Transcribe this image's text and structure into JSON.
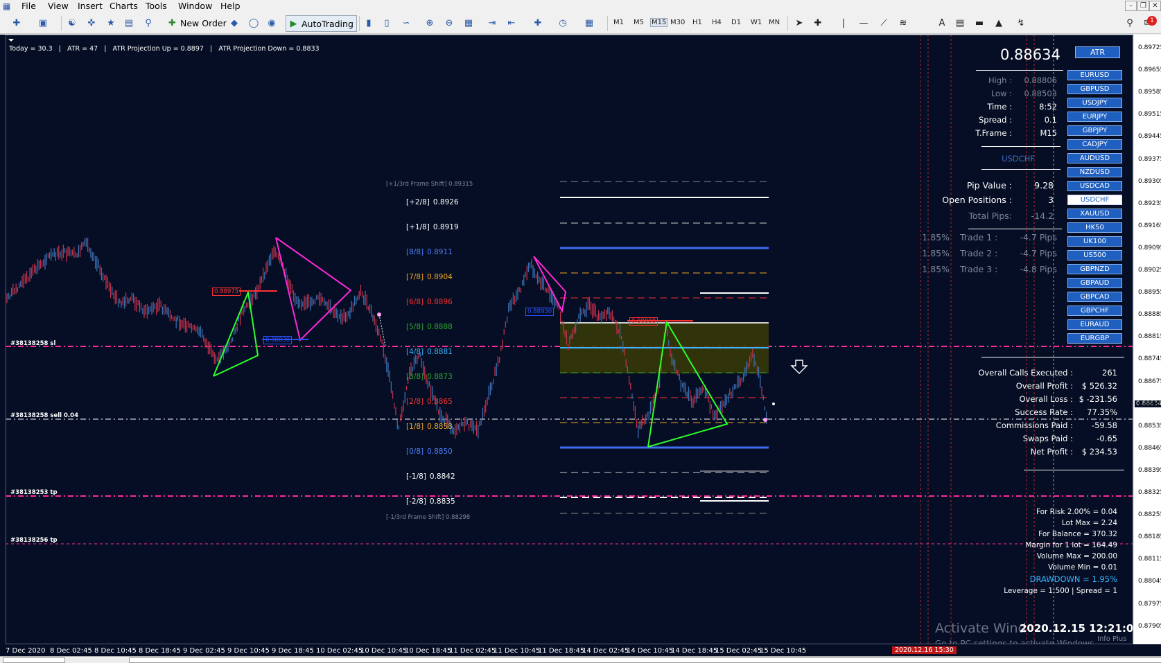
{
  "menu": {
    "items": [
      "File",
      "View",
      "Insert",
      "Charts",
      "Tools",
      "Window",
      "Help"
    ]
  },
  "toolbar": {
    "new_order": "New Order",
    "autotrading": "AutoTrading",
    "timeframes": [
      "M1",
      "M5",
      "M15",
      "M30",
      "H1",
      "H4",
      "D1",
      "W1",
      "MN"
    ],
    "active_timeframe": "M15",
    "notification_count": "1"
  },
  "info_line": "Today = 30.3   |   ATR = 47   |   ATR Projection Up = 0.8897   |   ATR Projection Down = 0.8833",
  "murrey": {
    "frame_shift_up": "[+1/3rd Frame Shift]  0.89315",
    "frame_shift_down": "[-1/3rd Frame Shift]  0.88298",
    "levels": [
      {
        "tag": "[+2/8]",
        "value": "0.8926",
        "color": "#ffffff"
      },
      {
        "tag": "[+1/8]",
        "value": "0.8919",
        "color": "#ffffff"
      },
      {
        "tag": "[8/8]",
        "value": "0.8911",
        "color": "#4f7fff"
      },
      {
        "tag": "[7/8]",
        "value": "0.8904",
        "color": "#f5a623"
      },
      {
        "tag": "[6/8]",
        "value": "0.8896",
        "color": "#ff3030"
      },
      {
        "tag": "[5/8]",
        "value": "0.8888",
        "color": "#2fa82f"
      },
      {
        "tag": "[4/8]",
        "value": "0.8881",
        "color": "#3ab4ff"
      },
      {
        "tag": "[3/8]",
        "value": "0.8873",
        "color": "#2fa82f"
      },
      {
        "tag": "[2/8]",
        "value": "0.8865",
        "color": "#ff3030"
      },
      {
        "tag": "[1/8]",
        "value": "0.8858",
        "color": "#f5a623"
      },
      {
        "tag": "[0/8]",
        "value": "0.8850",
        "color": "#4f7fff"
      },
      {
        "tag": "[-1/8]",
        "value": "0.8842",
        "color": "#ffffff"
      },
      {
        "tag": "[-2/8]",
        "value": "0.8835",
        "color": "#ffffff"
      }
    ]
  },
  "chart_labels": {
    "pattern_left_high": "0.88975",
    "pattern_left_low": "0.88830",
    "pattern_mid": "0.88930",
    "pattern_right_high": "0.88888",
    "trade_sl": "#38138258 sl",
    "trade_sell": "#38138258 sell 0.04",
    "trade_tp": "#38138253 tp",
    "trade_tp2": "#38138256 tp"
  },
  "panel": {
    "price": "0.88634",
    "atr_button": "ATR",
    "high_label": "High :",
    "high_value": "0.88806",
    "low_label": "Low :",
    "low_value": "0.88503",
    "time_label": "Time :",
    "time_value": "8:52",
    "spread_label": "Spread :",
    "spread_value": "0.1",
    "tframe_label": "T.Frame :",
    "tframe_value": "M15",
    "symbol": "USDCHF",
    "pip_value_label": "Pip Value :",
    "pip_value": "9.28",
    "open_positions_label": "Open Positions :",
    "open_positions": "3",
    "total_pips_label": "Total Pips:",
    "total_pips": "-14.2",
    "trades": [
      {
        "pct": "1.85%",
        "label": "Trade 1 :",
        "pips": "-4.7 Pips"
      },
      {
        "pct": "1.85%",
        "label": "Trade 2 :",
        "pips": "-4.7 Pips"
      },
      {
        "pct": "1.85%",
        "label": "Trade 3 :",
        "pips": "-4.8 Pips"
      }
    ],
    "stats": [
      {
        "label": "Overall Calls Executed :",
        "value": "261"
      },
      {
        "label": "Overall Profit :",
        "value": "$ 526.32"
      },
      {
        "label": "Overall Loss :",
        "value": "$ -231.56"
      },
      {
        "label": "Success Rate :",
        "value": "77.35%"
      },
      {
        "label": "Commissions Paid :",
        "value": "-59.58"
      },
      {
        "label": "Swaps Paid :",
        "value": "-0.65"
      },
      {
        "label": "Net Profit :",
        "value": "$ 234.53"
      }
    ],
    "risk": [
      "For Risk 2.00% = 0.04",
      "Lot Max = 2.24",
      "For Balance = 370.32",
      "Margin for 1 lot = 164.49",
      "Volume Max = 200.00",
      "Volume Min = 0.01"
    ],
    "drawdown": "DRAWDOWN =  1.95%",
    "leverage": "Leverage = 1:500 | Spread = 1",
    "datetime": "2020.12.15 12:21:08",
    "info_plus": "Info Plus"
  },
  "symbols": [
    "EURUSD",
    "GBPUSD",
    "USDJPY",
    "EURJPY",
    "GBPJPY",
    "CADJPY",
    "AUDUSD",
    "NZDUSD",
    "USDCAD",
    "USDCHF",
    "XAUUSD",
    "HK50",
    "UK100",
    "US500",
    "GBPNZD",
    "GBPAUD",
    "GBPCAD",
    "GBPCHF",
    "EURAUD",
    "EURGBP"
  ],
  "active_symbol": "USDCHF",
  "price_axis": [
    "0.89725",
    "0.89655",
    "0.89585",
    "0.89515",
    "0.89445",
    "0.89375",
    "0.89305",
    "0.89235",
    "0.89165",
    "0.89095",
    "0.89025",
    "0.88955",
    "0.88885",
    "0.88815",
    "0.88745",
    "0.88675",
    "0.88634",
    "0.88605",
    "0.88535",
    "0.88465",
    "0.88395",
    "0.88325",
    "0.88255",
    "0.88185",
    "0.88115",
    "0.88045",
    "0.87975",
    "0.87905"
  ],
  "current_price_tag": "0.88634",
  "date_axis": [
    "7 Dec 2020",
    "8 Dec 02:45",
    "8 Dec 10:45",
    "8 Dec 18:45",
    "9 Dec 02:45",
    "9 Dec 10:45",
    "9 Dec 18:45",
    "10 Dec 02:45",
    "10 Dec 10:45",
    "10 Dec 18:45",
    "11 Dec 02:45",
    "11 Dec 10:45",
    "11 Dec 18:45",
    "14 Dec 02:45",
    "14 Dec 10:45",
    "14 Dec 18:45",
    "15 Dec 02:45",
    "15 Dec 10:45"
  ],
  "date_highlight": "2020.12.16 15:30",
  "watermark": {
    "title": "Activate Wind",
    "subtitle": "Go to PC settings to activate Windows."
  }
}
